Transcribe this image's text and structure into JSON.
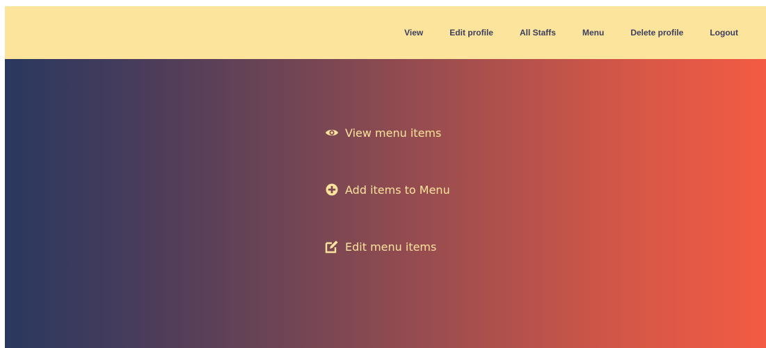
{
  "nav": {
    "items": [
      {
        "label": "View"
      },
      {
        "label": "Edit profile"
      },
      {
        "label": "All Staffs"
      },
      {
        "label": "Menu"
      },
      {
        "label": "Delete profile"
      },
      {
        "label": "Logout"
      }
    ]
  },
  "menu": {
    "items": [
      {
        "label": "View menu items",
        "icon": "eye-icon"
      },
      {
        "label": "Add items to Menu",
        "icon": "plus-circle-icon"
      },
      {
        "label": "Edit menu items",
        "icon": "edit-icon"
      }
    ]
  },
  "colors": {
    "topbar_bg": "#fde49c",
    "nav_text": "#3a3f5e",
    "menu_text": "#fde49c",
    "gradient_start": "#2a385f",
    "gradient_end": "#f35b43"
  }
}
